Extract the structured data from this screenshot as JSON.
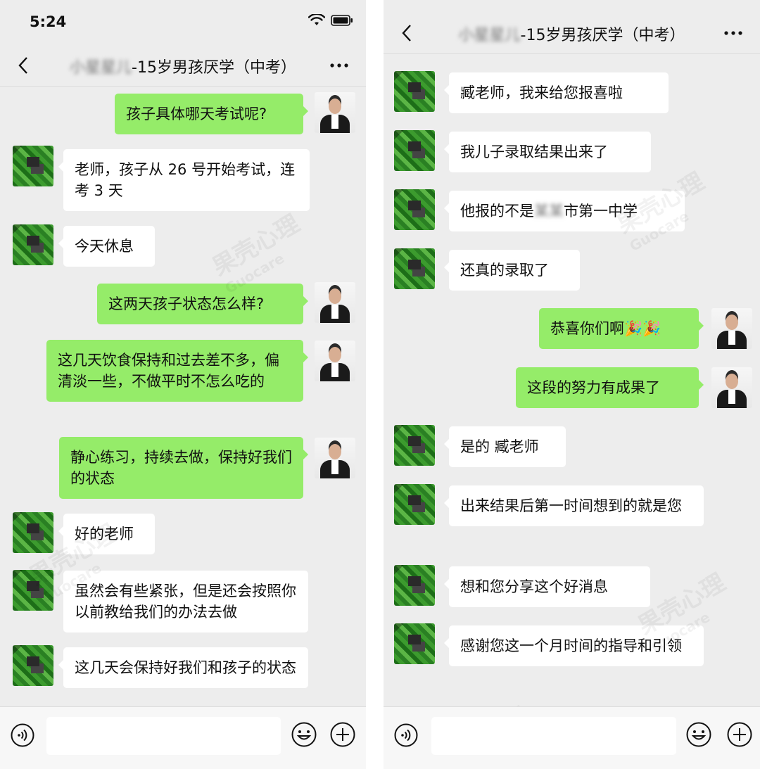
{
  "left_panel": {
    "status_time": "5:24",
    "title_blurred": "小星星儿",
    "title_text": "-15岁男孩厌学（中考）",
    "messages": [
      {
        "side": "out",
        "text": "孩子具体哪天考试呢?"
      },
      {
        "side": "in",
        "text": "老师，孩子从 26 号开始考试，连考 3 天"
      },
      {
        "side": "in",
        "text": "今天休息"
      },
      {
        "side": "out",
        "text": "这两天孩子状态怎么样?"
      },
      {
        "side": "out",
        "text": "这几天饮食保持和过去差不多，偏清淡一些，不做平时不怎么吃的"
      },
      {
        "side": "out",
        "text": "静心练习，持续去做，保持好我们的状态"
      },
      {
        "side": "in",
        "text": "好的老师"
      },
      {
        "side": "in",
        "text": "虽然会有些紧张，但是还会按照你以前教给我们的办法去做"
      },
      {
        "side": "in",
        "text": "这几天会保持好我们和孩子的状态"
      }
    ]
  },
  "right_panel": {
    "title_blurred": "小星星儿",
    "title_text": "-15岁男孩厌学（中考）",
    "messages": [
      {
        "side": "in",
        "text": "臧老师，我来给您报喜啦"
      },
      {
        "side": "in",
        "text": "我儿子录取结果出来了"
      },
      {
        "side": "in",
        "text_before": "他报的不是",
        "text_blurred": "某某",
        "text_after": "市第一中学"
      },
      {
        "side": "in",
        "text": "还真的录取了"
      },
      {
        "side": "out",
        "text": "恭喜你们啊🎉🎉"
      },
      {
        "side": "out",
        "text": "这段的努力有成果了"
      },
      {
        "side": "in",
        "text": "是的 臧老师"
      },
      {
        "side": "in",
        "text": "出来结果后第一时间想到的就是您"
      },
      {
        "side": "in",
        "text": "想和您分享这个好消息"
      },
      {
        "side": "in",
        "text": "感谢您这一个月时间的指导和引领"
      }
    ]
  },
  "watermark": {
    "cn": "果壳心理",
    "en": "Guocare"
  },
  "icons": [
    "wifi-icon",
    "battery-icon",
    "back-icon",
    "more-icon",
    "voice-icon",
    "emoji-icon",
    "plus-icon"
  ],
  "colors": {
    "background": "#ededed",
    "bubble_out": "#95ec69",
    "bubble_in": "#ffffff"
  }
}
